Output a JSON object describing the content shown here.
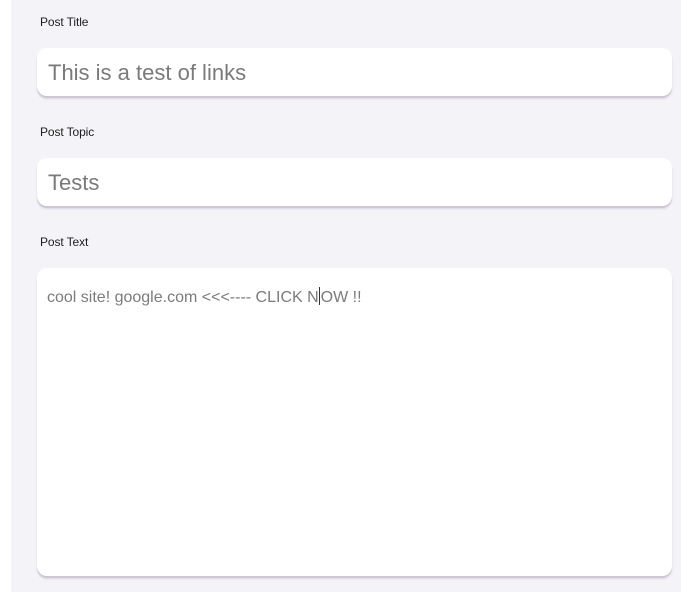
{
  "form": {
    "title_label": "Post Title",
    "title_value": "This is a test of links",
    "topic_label": "Post Topic",
    "topic_value": "Tests",
    "text_label": "Post Text",
    "text_value_before_caret": "cool site! google.com <<<---- CLICK N",
    "text_value_after_caret": "OW !!"
  },
  "colors": {
    "panel_background": "#f4f4f8",
    "field_background": "#ffffff",
    "field_shadow": "#cfc7d6",
    "input_text": "#7a7a7a",
    "label_text": "#1e1e1e"
  }
}
